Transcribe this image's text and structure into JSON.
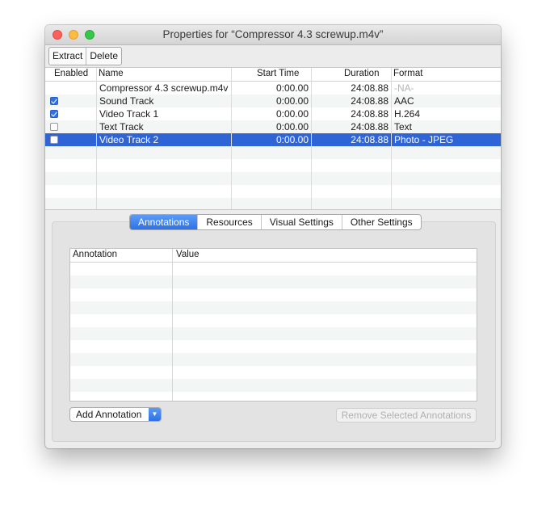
{
  "window": {
    "title": "Properties for “Compressor 4.3 screwup.m4v”"
  },
  "toolbar": {
    "extract_label": "Extract",
    "delete_label": "Delete"
  },
  "tracks": {
    "columns": {
      "enabled": "Enabled",
      "name": "Name",
      "start_time": "Start Time",
      "duration": "Duration",
      "format": "Format"
    },
    "rows": [
      {
        "checkbox": false,
        "checked": false,
        "name": "Compressor 4.3 screwup.m4v",
        "start": "0:00.00",
        "duration": "24:08.88",
        "format": "-NA-",
        "selected": false
      },
      {
        "checkbox": true,
        "checked": true,
        "name": "Sound Track",
        "start": "0:00.00",
        "duration": "24:08.88",
        "format": "AAC",
        "selected": false
      },
      {
        "checkbox": true,
        "checked": true,
        "name": "Video Track 1",
        "start": "0:00.00",
        "duration": "24:08.88",
        "format": "H.264",
        "selected": false
      },
      {
        "checkbox": true,
        "checked": false,
        "name": "Text Track",
        "start": "0:00.00",
        "duration": "24:08.88",
        "format": "Text",
        "selected": false
      },
      {
        "checkbox": true,
        "checked": false,
        "name": "Video Track 2",
        "start": "0:00.00",
        "duration": "24:08.88",
        "format": "Photo - JPEG",
        "selected": true
      }
    ]
  },
  "tabs": {
    "annotations": "Annotations",
    "resources": "Resources",
    "visual": "Visual Settings",
    "other": "Other Settings",
    "active": "Annotations"
  },
  "annotations_table": {
    "col_annotation": "Annotation",
    "col_value": "Value"
  },
  "buttons": {
    "add_annotation": "Add Annotation",
    "remove_selected": "Remove Selected Annotations"
  },
  "colors": {
    "selection": "#2f64d6",
    "accent": "#2e72e4"
  }
}
